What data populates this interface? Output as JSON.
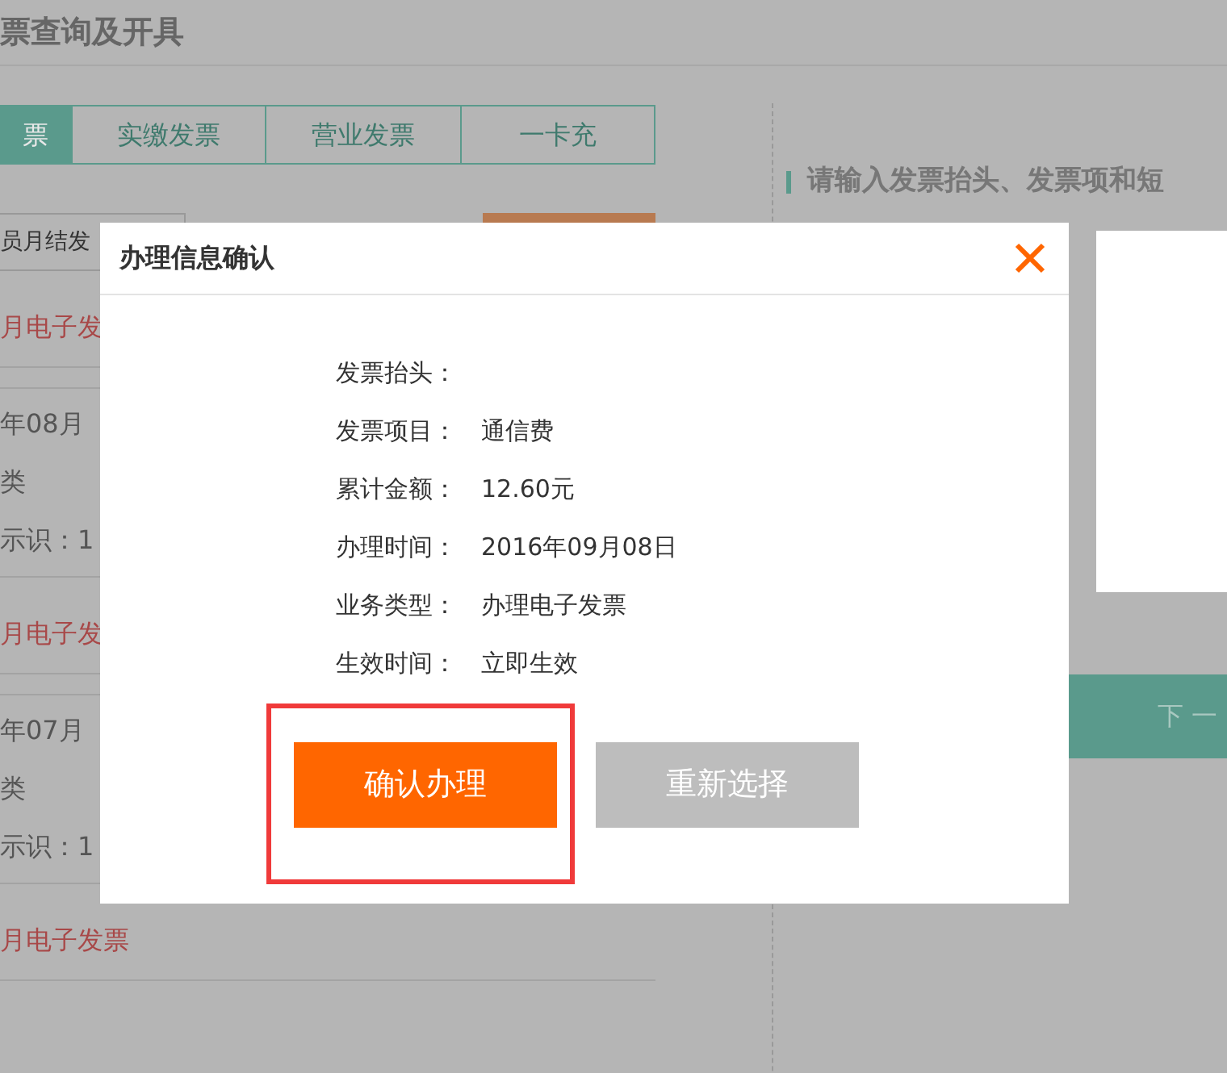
{
  "page": {
    "title": "票查询及开具"
  },
  "tabs": [
    {
      "label": "票",
      "selected": true
    },
    {
      "label": "实缴发票",
      "selected": false
    },
    {
      "label": "营业发票",
      "selected": false
    },
    {
      "label": "一卡充",
      "selected": false
    }
  ],
  "type_select": {
    "value": "员月结发"
  },
  "records": [
    {
      "title": "月电子发",
      "month": "年08月",
      "type": "类",
      "id": "示识：1"
    },
    {
      "title": "月电子发",
      "month": "年07月",
      "type": "类",
      "id": "示识：1"
    },
    {
      "title": "月电子发票"
    }
  ],
  "right_panel": {
    "heading": "请输入发票抬头、发票项和短",
    "next_button": "下 一"
  },
  "dialog": {
    "title": "办理信息确认",
    "highlight": true,
    "fields": [
      {
        "label": "发票抬头："
      },
      {
        "label": "发票项目：",
        "value": "通信费"
      },
      {
        "label": "累计金额：",
        "value": "12.60元"
      },
      {
        "label": "办理时间：",
        "value": "2016年09月08日"
      },
      {
        "label": "业务类型：",
        "value": "办理电子发票"
      },
      {
        "label": "生效时间：",
        "value": "立即生效"
      }
    ],
    "buttons": [
      {
        "label": "确认办理",
        "kind": "primary"
      },
      {
        "label": "重新选择",
        "kind": "secondary"
      }
    ]
  }
}
